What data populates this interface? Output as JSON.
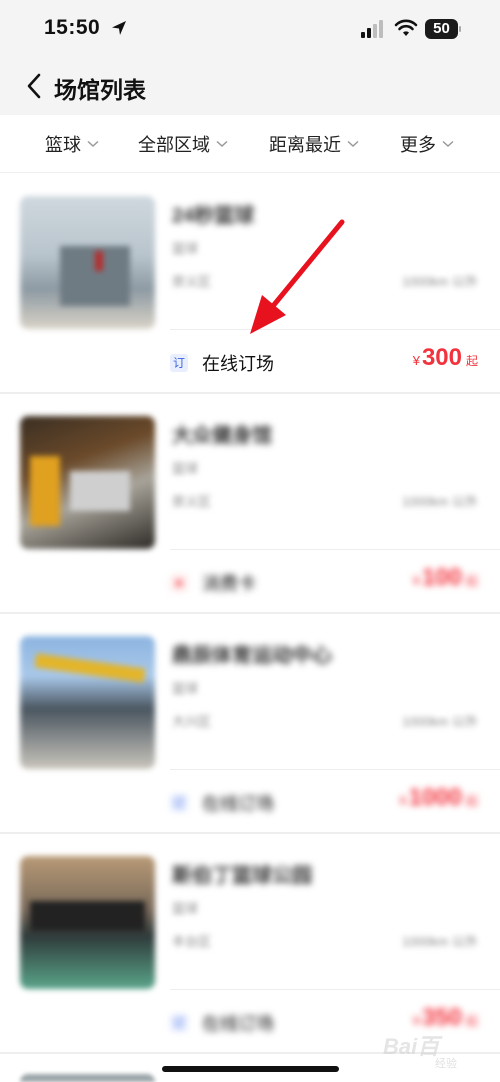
{
  "status_bar": {
    "time": "15:50",
    "battery": "50",
    "icons": [
      "location-arrow-icon",
      "signal-icon",
      "wifi-icon",
      "battery-icon"
    ]
  },
  "nav": {
    "title": "场馆列表",
    "back_icon": "chevron-left-icon"
  },
  "filters": [
    {
      "label": "篮球"
    },
    {
      "label": "全部区域"
    },
    {
      "label": "距离最近"
    },
    {
      "label": "更多"
    }
  ],
  "venues": [
    {
      "name": "24秒篮球",
      "sport": "篮球",
      "area": "崇义区",
      "distance": "1000km 以外",
      "booking_tag": "订",
      "booking_label": "在线订场",
      "currency": "¥",
      "price": "300",
      "price_suffix": "起"
    },
    {
      "name": "大众健身馆",
      "sport": "篮球",
      "area": "崇义区",
      "distance": "1000km 以外",
      "booking_tag": "★",
      "booking_label": "消费卡",
      "currency": "¥",
      "price": "100",
      "price_suffix": "起"
    },
    {
      "name": "鼎辰体育运动中心",
      "sport": "篮球",
      "area": "大兴区",
      "distance": "1000km 以外",
      "booking_tag": "订",
      "booking_label": "在线订场",
      "currency": "¥",
      "price": "1000",
      "price_suffix": "起"
    },
    {
      "name": "斯伯丁篮球公园",
      "sport": "篮球",
      "area": "丰台区",
      "distance": "1000km 以外",
      "booking_tag": "订",
      "booking_label": "在线订场",
      "currency": "¥",
      "price": "350",
      "price_suffix": "起"
    }
  ],
  "watermark": {
    "brand": "Bai百",
    "sub": "经验"
  },
  "colors": {
    "price": "#f2333d",
    "annotation_arrow": "#e8121f",
    "tag_bg": "#e9efff",
    "tag_fg": "#3b66e0"
  }
}
